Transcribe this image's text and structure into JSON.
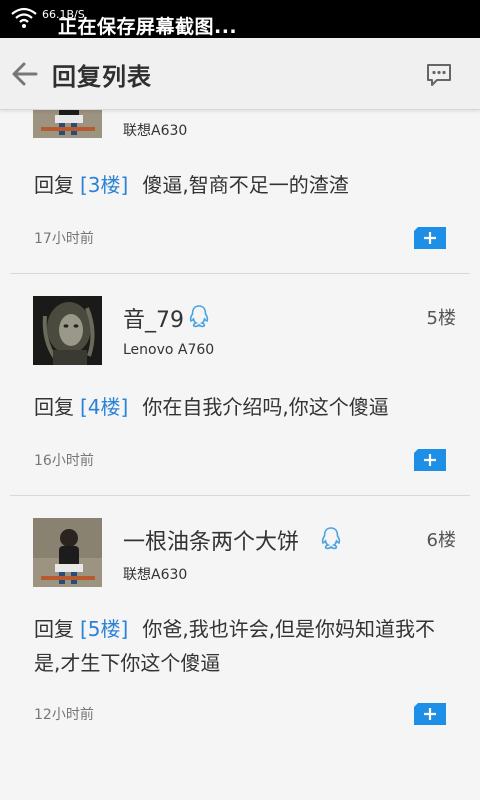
{
  "status_bar": {
    "net_speed": "66.1B/S",
    "notice": "正在保存屏幕截图..."
  },
  "header": {
    "title": "回复列表",
    "back_icon": "arrow-left-icon",
    "comment_icon": "comment-icon"
  },
  "colors": {
    "accent_blue": "#2b83d6",
    "plus_blue": "#1e8fe6",
    "qq_icon": "#4aa3e0"
  },
  "replies": [
    {
      "device": "联想A630",
      "reply_prefix": "回复",
      "reply_floor": "[3楼]",
      "reply_text": "傻逼,智商不足一的渣渣",
      "time": "17小时前"
    },
    {
      "username": "音_79",
      "floor": "5楼",
      "device": "Lenovo A760",
      "reply_prefix": "回复",
      "reply_floor": "[4楼]",
      "reply_text": "你在自我介绍吗,你这个傻逼",
      "time": "16小时前"
    },
    {
      "username": "一根油条两个大饼",
      "floor": "6楼",
      "device": "联想A630",
      "reply_prefix": "回复",
      "reply_floor": "[5楼]",
      "reply_text": "你爸,我也许会,但是你妈知道我不是,才生下你这个傻逼",
      "time": "12小时前"
    }
  ]
}
